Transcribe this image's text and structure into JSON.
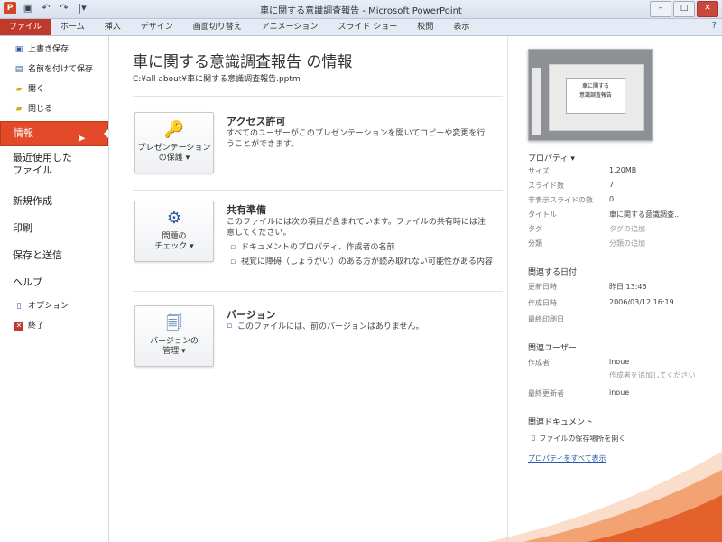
{
  "window": {
    "title": "車に関する意識調査報告 - Microsoft PowerPoint",
    "controls": {
      "minimize": "–",
      "maximize": "□",
      "close": "✕"
    }
  },
  "qat": {
    "app": "P",
    "save": "▣",
    "undo": "↶",
    "redo": "↷",
    "customize": "|▾"
  },
  "ribbon": {
    "tabs": [
      "ファイル",
      "ホーム",
      "挿入",
      "デザイン",
      "画面切り替え",
      "アニメーション",
      "スライド ショー",
      "校閲",
      "表示"
    ],
    "help": "?"
  },
  "nav": {
    "save": "上書き保存",
    "saveas": "名前を付けて保存",
    "open": "開く",
    "close": "閉じる",
    "info": "情報",
    "recent": "最近使用した\nファイル",
    "new": "新規作成",
    "print": "印刷",
    "sendsave": "保存と送信",
    "help": "ヘルプ",
    "options": "オプション",
    "exit": "終了"
  },
  "main": {
    "title": "車に関する意識調査報告 の情報",
    "path": "C:¥all about¥車に関する意識調査報告.pptm",
    "permissions": {
      "button": "プレゼンテーション\nの保護 ▾",
      "title": "アクセス許可",
      "desc": "すべてのユーザーがこのプレゼンテーションを開いてコピーや変更を行うことができます。"
    },
    "prepare": {
      "button": "問題の\nチェック ▾",
      "title": "共有準備",
      "desc": "このファイルには次の項目が含まれています。ファイルの共有時には注意してください。",
      "items": [
        "ドキュメントのプロパティ、作成者の名前",
        "視覚に障碍（しょうがい）のある方が読み取れない可能性がある内容"
      ]
    },
    "versions": {
      "button": "バージョンの\n管理 ▾",
      "title": "バージョン",
      "desc": "このファイルには、前のバージョンはありません。"
    }
  },
  "thumbnail": {
    "text": "車に関する\n意識調査報告"
  },
  "properties": {
    "header": "プロパティ ▾",
    "rows": [
      {
        "k": "サイズ",
        "v": "1.20MB"
      },
      {
        "k": "スライド数",
        "v": "7"
      },
      {
        "k": "非表示スライドの数",
        "v": "0"
      },
      {
        "k": "タイトル",
        "v": "車に関する意識調査..."
      },
      {
        "k": "タグ",
        "v": "タグの追加"
      },
      {
        "k": "分類",
        "v": "分類の追加"
      }
    ]
  },
  "dates": {
    "header": "関連する日付",
    "rows": [
      {
        "k": "更新日時",
        "v": "昨日 13:46"
      },
      {
        "k": "作成日時",
        "v": "2006/03/12 16:19"
      },
      {
        "k": "最終印刷日",
        "v": ""
      }
    ]
  },
  "people": {
    "header": "関連ユーザー",
    "author_k": "作成者",
    "author_v": "inoue",
    "add_author": "作成者を追加してください",
    "lastmod_k": "最終更新者",
    "lastmod_v": "inoue"
  },
  "documents": {
    "header": "関連ドキュメント",
    "open_location": "ファイルの保存場所を開く",
    "show_all": "プロパティをすべて表示"
  }
}
